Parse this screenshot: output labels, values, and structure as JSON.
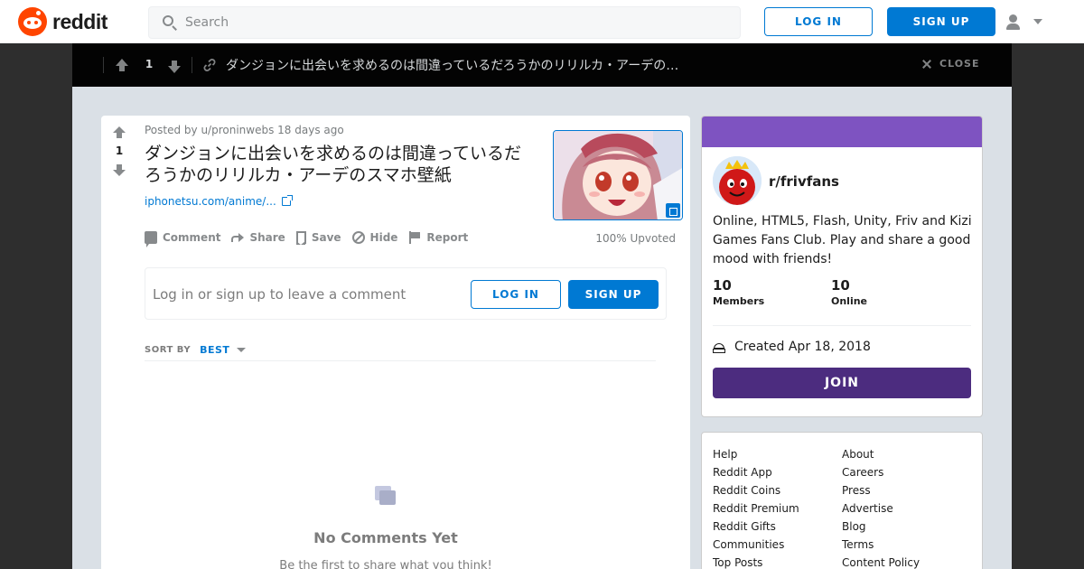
{
  "header": {
    "logo_text": "reddit",
    "search_placeholder": "Search",
    "login_label": "LOG IN",
    "signup_label": "SIGN UP"
  },
  "post_bar": {
    "score": "1",
    "title": "ダンジョンに出会いを求めるのは間違っているだろうかのリリルカ・アーデの…",
    "close_label": "CLOSE"
  },
  "post": {
    "score": "1",
    "posted_by": "Posted by u/proninwebs 18 days ago",
    "title": "ダンジョンに出会いを求めるのは間違っているだろうかのリリルカ・アーデのスマホ壁紙",
    "link_text": "iphonetsu.com/anime/...",
    "actions": {
      "comment": "Comment",
      "share": "Share",
      "save": "Save",
      "hide": "Hide",
      "report": "Report"
    },
    "upvoted": "100% Upvoted"
  },
  "comment_box": {
    "prompt": "Log in or sign up to leave a comment",
    "login_label": "LOG IN",
    "signup_label": "SIGN UP"
  },
  "sort": {
    "label": "SORT BY",
    "value": "BEST"
  },
  "empty_state": {
    "title": "No Comments Yet",
    "subtitle": "Be the first to share what you think!"
  },
  "community": {
    "name": "r/frivfans",
    "description": "Online, HTML5, Flash, Unity, Friv and Kizi Games Fans Club. Play and share a good mood with friends!",
    "members_count": "10",
    "members_label": "Members",
    "online_count": "10",
    "online_label": "Online",
    "created": "Created Apr 18, 2018",
    "join_label": "JOIN",
    "banner_color": "#7e53c1",
    "join_color": "#4c2c7f"
  },
  "footer_links": {
    "col1": [
      "Help",
      "Reddit App",
      "Reddit Coins",
      "Reddit Premium",
      "Reddit Gifts",
      "Communities",
      "Top Posts"
    ],
    "col2": [
      "About",
      "Careers",
      "Press",
      "Advertise",
      "Blog",
      "Terms",
      "Content Policy"
    ]
  },
  "colors": {
    "brand": "#ff4500",
    "accent": "#0079d3"
  }
}
